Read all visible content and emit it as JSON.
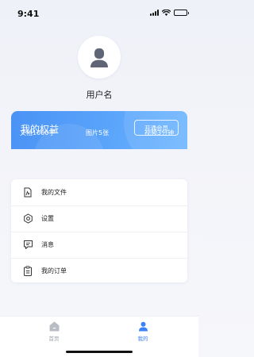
{
  "status_bar": {
    "time": "9:41"
  },
  "profile": {
    "username": "用户名"
  },
  "benefits": {
    "title": "我的权益",
    "action_label": "开通会员",
    "quotas": [
      "文档1000字",
      "图片5张",
      "视频3分钟"
    ]
  },
  "menu": {
    "items": [
      {
        "label": "我的文件",
        "icon": "file-icon"
      },
      {
        "label": "设置",
        "icon": "settings-icon"
      },
      {
        "label": "消息",
        "icon": "message-icon"
      },
      {
        "label": "我的订单",
        "icon": "order-icon"
      }
    ]
  },
  "tab_bar": {
    "tabs": [
      {
        "label": "首页",
        "icon": "home-icon",
        "active": false
      },
      {
        "label": "我的",
        "icon": "profile-icon",
        "active": true
      }
    ],
    "active_color": "#3b82f6",
    "inactive_color": "#9aa0aa"
  },
  "colors": {
    "accent": "#4a93f5"
  }
}
